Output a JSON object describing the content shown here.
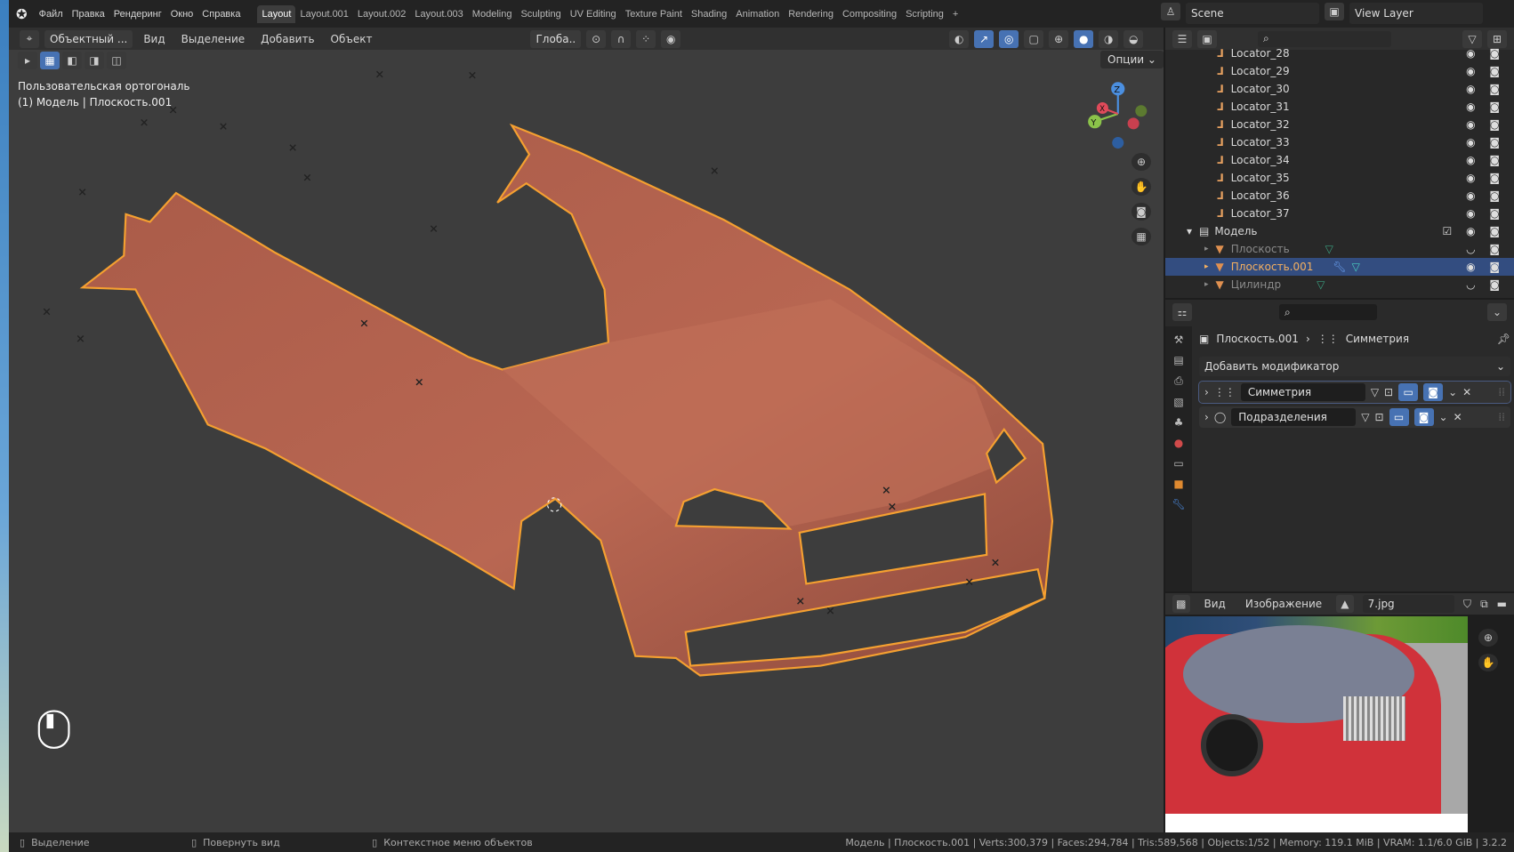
{
  "topbar": {
    "menus": [
      "Файл",
      "Правка",
      "Рендеринг",
      "Окно",
      "Справка"
    ],
    "workspaces": [
      "Layout",
      "Layout.001",
      "Layout.002",
      "Layout.003",
      "Modeling",
      "Sculpting",
      "UV Editing",
      "Texture Paint",
      "Shading",
      "Animation",
      "Rendering",
      "Compositing",
      "Scripting"
    ],
    "active_workspace": "Layout",
    "add": "+",
    "scene": "Scene",
    "view_layer": "View Layer"
  },
  "viewport_header": {
    "mode": "Объектный ...",
    "menus": [
      "Вид",
      "Выделение",
      "Добавить",
      "Объект"
    ],
    "transform": "Глоба..",
    "options": "Опции"
  },
  "viewport": {
    "view_name": "Пользовательская ортогональ",
    "object_info": "(1) Модель | Плоскость.001",
    "gizmo": {
      "z": "Z",
      "y": "Y",
      "x": "X"
    },
    "mesh_color": "#b8644e",
    "outline_color": "#f5a030"
  },
  "outliner": {
    "items": [
      {
        "label": "Locator_28",
        "type": "locator"
      },
      {
        "label": "Locator_29",
        "type": "locator"
      },
      {
        "label": "Locator_30",
        "type": "locator"
      },
      {
        "label": "Locator_31",
        "type": "locator"
      },
      {
        "label": "Locator_32",
        "type": "locator"
      },
      {
        "label": "Locator_33",
        "type": "locator"
      },
      {
        "label": "Locator_34",
        "type": "locator"
      },
      {
        "label": "Locator_35",
        "type": "locator"
      },
      {
        "label": "Locator_36",
        "type": "locator"
      },
      {
        "label": "Locator_37",
        "type": "locator"
      },
      {
        "label": "Модель",
        "type": "collection"
      },
      {
        "label": "Плоскость",
        "type": "mesh",
        "hidden": true
      },
      {
        "label": "Плоскость.001",
        "type": "mesh",
        "selected": true
      },
      {
        "label": "Цилиндр",
        "type": "mesh",
        "hidden": true
      }
    ]
  },
  "properties": {
    "object": "Плоскость.001",
    "modifier_crumb": "Симметрия",
    "add_modifier": "Добавить модификатор",
    "modifiers": [
      {
        "name": "Симметрия"
      },
      {
        "name": "Подразделения"
      }
    ]
  },
  "image_editor": {
    "menus": [
      "Вид",
      "Изображение"
    ],
    "image": "7.jpg"
  },
  "status": {
    "left": [
      "Выделение",
      "Повернуть вид",
      "Контекстное меню объектов"
    ],
    "right": "Модель | Плоскость.001 | Verts:300,379 | Faces:294,784 | Tris:589,568 | Objects:1/52 | Memory: 119.1 MiB | VRAM: 1.1/6.0 GiB | 3.2.2"
  }
}
